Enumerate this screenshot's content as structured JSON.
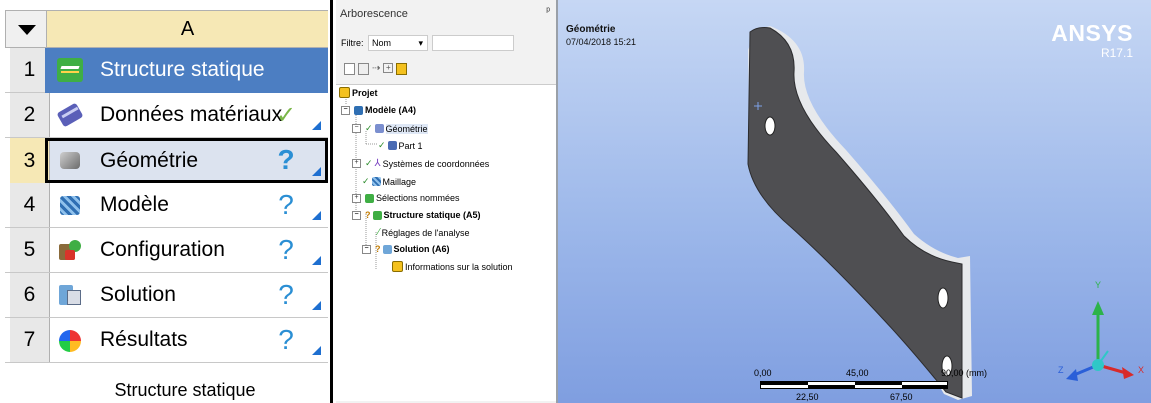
{
  "workbench": {
    "column_letter": "A",
    "rows": [
      {
        "num": "1",
        "label": "Structure statique",
        "icon": "static-structural-icon",
        "status": ""
      },
      {
        "num": "2",
        "label": "Données matériaux",
        "icon": "engineering-data-icon",
        "status": "✓"
      },
      {
        "num": "3",
        "label": "Géométrie",
        "icon": "geometry-icon",
        "status": "?"
      },
      {
        "num": "4",
        "label": "Modèle",
        "icon": "model-icon",
        "status": "?"
      },
      {
        "num": "5",
        "label": "Configuration",
        "icon": "setup-icon",
        "status": "?"
      },
      {
        "num": "6",
        "label": "Solution",
        "icon": "solution-icon",
        "status": "?"
      },
      {
        "num": "7",
        "label": "Résultats",
        "icon": "results-icon",
        "status": "?"
      }
    ],
    "footer_label": "Structure statique"
  },
  "tree": {
    "title": "Arborescence",
    "pin": "ᵖ",
    "filter_label": "Filtre:",
    "filter_value": "Nom",
    "nodes": {
      "projet": "Projet",
      "modele": "Modèle (A4)",
      "geometrie": "Géométrie",
      "part1": "Part 1",
      "systemes": "Systèmes de coordonnées",
      "maillage": "Maillage",
      "selections": "Sélections nommées",
      "structure": "Structure statique (A5)",
      "reglages": "Réglages de l'analyse",
      "solution": "Solution (A6)",
      "informations": "Informations sur la solution"
    }
  },
  "viewport": {
    "title": "Géométrie",
    "date": "07/04/2018 15:21",
    "brand": "ANSYS",
    "version": "R17.1",
    "scale_top": [
      "0,00",
      "45,00",
      "90,00 (mm)"
    ],
    "scale_bottom": [
      "22,50",
      "67,50"
    ],
    "axis_x": "X",
    "axis_y": "Y",
    "axis_z": "Z"
  },
  "colors": {
    "selected_row": "#4c7ec2",
    "highlighted_row": "#dce3ef",
    "accent": "#1e6fd0",
    "check": "#7ab648",
    "part": "#4a4a4a"
  }
}
